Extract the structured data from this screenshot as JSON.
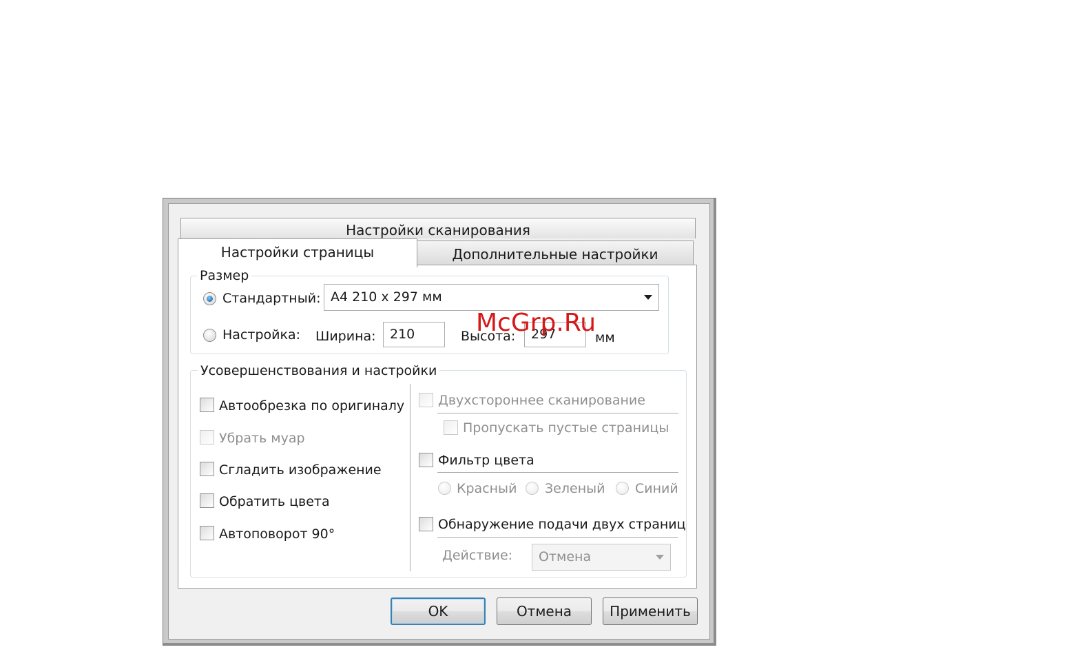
{
  "window": {
    "title": "Настройки сканирования"
  },
  "tabs": [
    {
      "label": "Настройки страницы",
      "active": true
    },
    {
      "label": "Дополнительные настройки",
      "active": false
    }
  ],
  "size_group": {
    "label": "Размер",
    "standard_label": "Стандартный:",
    "standard_value": "A4 210 x 297 мм",
    "custom_label": "Настройка:",
    "width_label": "Ширина:",
    "width_value": "210",
    "height_label": "Высота:",
    "height_value": "297",
    "unit": "мм",
    "selected": "standard"
  },
  "enhancements_group": {
    "label": "Усовершенствования и настройки",
    "left_options": [
      {
        "label": "Автообрезка по оригиналу",
        "checked": false,
        "enabled": true
      },
      {
        "label": "Убрать муар",
        "checked": false,
        "enabled": false
      },
      {
        "label": "Сгладить изображение",
        "checked": false,
        "enabled": true
      },
      {
        "label": "Обратить цвета",
        "checked": false,
        "enabled": true
      },
      {
        "label": "Автоповорот 90°",
        "checked": false,
        "enabled": true
      }
    ],
    "duplex": {
      "label": "Двухстороннее сканирование",
      "checked": false,
      "enabled": false
    },
    "skip_blank": {
      "label": "Пропускать пустые страницы",
      "checked": false,
      "enabled": false
    },
    "color_filter": {
      "label": "Фильтр цвета",
      "checked": false,
      "enabled": true
    },
    "colors": [
      "Красный",
      "Зеленый",
      "Синий"
    ],
    "double_feed": {
      "label": "Обнаружение подачи двух страниц",
      "checked": false,
      "enabled": true
    },
    "action_label": "Действие:",
    "action_value": "Отмена"
  },
  "buttons": {
    "ok": "OK",
    "cancel": "Отмена",
    "apply": "Применить"
  },
  "watermark": "McGrp.Ru"
}
